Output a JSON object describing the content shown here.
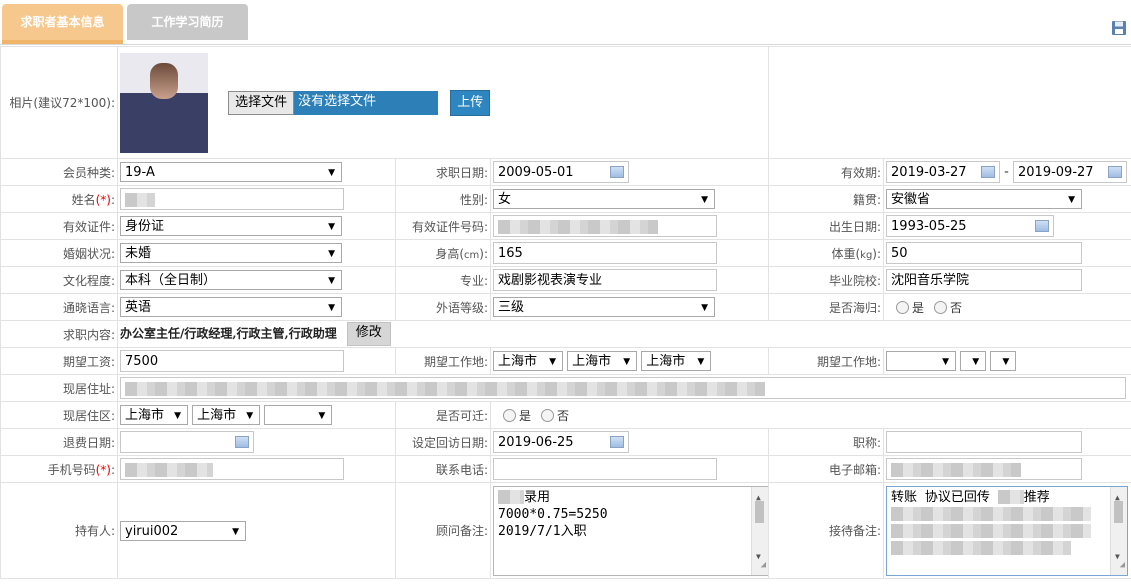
{
  "tabs": {
    "basic": "求职者基本信息",
    "work": "工作学习简历"
  },
  "photo": {
    "label": "相片(建议72*100):",
    "choose": "选择文件",
    "status": "没有选择文件",
    "upload": "上传"
  },
  "rows": {
    "member_type_label": "会员种类:",
    "member_type": "19-A",
    "apply_date_label": "求职日期:",
    "apply_date": "2009-05-01",
    "valid_label": "有效期:",
    "valid_from": "2019-03-27",
    "valid_sep": "-",
    "valid_to": "2019-09-27",
    "name_label": "姓名",
    "req": "(*)",
    "colon": ":",
    "gender_label": "性别:",
    "gender": "女",
    "native_label": "籍贯:",
    "native": "安徽省",
    "id_type_label": "有效证件:",
    "id_type": "身份证",
    "id_no_label": "有效证件号码:",
    "birth_label": "出生日期:",
    "birth": "1993-05-25",
    "marital_label": "婚姻状况:",
    "marital": "未婚",
    "height_label_a": "身高(",
    "height_unit": "cm",
    "height_label_b": "):",
    "height": "165",
    "weight_label_a": "体重(",
    "weight_unit": "kg",
    "weight_label_b": "):",
    "weight": "50",
    "edu_label": "文化程度:",
    "edu": "本科（全日制）",
    "major_label": "专业:",
    "major": "戏剧影视表演专业",
    "school_label": "毕业院校:",
    "school": "沈阳音乐学院",
    "lang_label": "通晓语言:",
    "lang": "英语",
    "lang_level_label": "外语等级:",
    "lang_level": "三级",
    "overseas_label": "是否海归:",
    "yes": "是",
    "no": "否",
    "job_label": "求职内容:",
    "job": "办公室主任/行政经理,行政主管,行政助理",
    "edit": "修改",
    "salary_label": "期望工资:",
    "salary": "7500",
    "work_place_label": "期望工作地:",
    "wp1": "上海市",
    "wp2": "上海市",
    "wp3": "上海市",
    "work_place_label2": "期望工作地:",
    "address_label": "现居住址:",
    "district_label": "现居住区:",
    "d1": "上海市",
    "d2": "上海市",
    "relocate_label": "是否可迁:",
    "refund_label": "退费日期:",
    "visit_label": "设定回访日期:",
    "visit": "2019-06-25",
    "title_label": "职称:",
    "mobile_label": "手机号码",
    "phone_label": "联系电话:",
    "email_label": "电子邮箱:",
    "holder_label": "持有人:",
    "holder": "yirui002",
    "advisor_label": "顾问备注:",
    "advisor_l1": "录用",
    "advisor_l2": "7000*0.75=5250",
    "advisor_l3": "2019/7/1入职",
    "reception_label": "接待备注:",
    "reception_l1a": "转账  协议已回传",
    "reception_l1b": "推荐"
  },
  "icons": {
    "save": "floppy-disk-icon",
    "calendar": "calendar-icon",
    "dropdown": "chevron-down-icon"
  }
}
